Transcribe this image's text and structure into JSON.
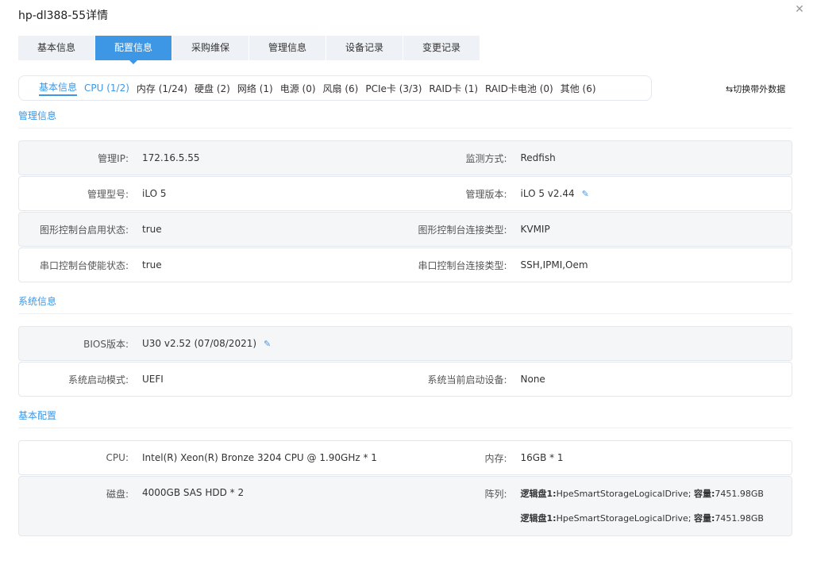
{
  "window": {
    "title": "hp-dl388-55详情"
  },
  "tabs": [
    {
      "label": "基本信息"
    },
    {
      "label": "配置信息"
    },
    {
      "label": "采购维保"
    },
    {
      "label": "管理信息"
    },
    {
      "label": "设备记录"
    },
    {
      "label": "变更记录"
    }
  ],
  "subtabs": [
    {
      "label": "基本信息"
    },
    {
      "label": "CPU (1/2)"
    },
    {
      "label": "内存 (1/24)"
    },
    {
      "label": "硬盘 (2)"
    },
    {
      "label": "网络 (1)"
    },
    {
      "label": "电源 (0)"
    },
    {
      "label": "风扇 (6)"
    },
    {
      "label": "PCIe卡 (3/3)"
    },
    {
      "label": "RAID卡 (1)"
    },
    {
      "label": "RAID卡电池 (0)"
    },
    {
      "label": "其他 (6)"
    }
  ],
  "oob_toggle": "⇆切换带外数据",
  "mgmt": {
    "title": "管理信息",
    "rows": [
      {
        "l1": "管理IP:",
        "v1": "172.16.5.55",
        "l2": "监测方式:",
        "v2": "Redfish"
      },
      {
        "l1": "管理型号:",
        "v1": "iLO 5",
        "l2": "管理版本:",
        "v2": "iLO 5 v2.44"
      },
      {
        "l1": "图形控制台启用状态:",
        "v1": "true",
        "l2": "图形控制台连接类型:",
        "v2": "KVMIP"
      },
      {
        "l1": "串口控制台使能状态:",
        "v1": "true",
        "l2": "串口控制台连接类型:",
        "v2": "SSH,IPMI,Oem"
      }
    ]
  },
  "sys": {
    "title": "系统信息",
    "bios_label": "BIOS版本:",
    "bios_value": "U30 v2.52 (07/08/2021)",
    "boot_mode_label": "系统启动模式:",
    "boot_mode_value": "UEFI",
    "boot_device_label": "系统当前启动设备:",
    "boot_device_value": "None"
  },
  "basic": {
    "title": "基本配置",
    "cpu_label": "CPU:",
    "cpu_value": "Intel(R) Xeon(R) Bronze 3204 CPU @ 1.90GHz * 1",
    "mem_label": "内存:",
    "mem_value": "16GB * 1",
    "disk_label": "磁盘:",
    "disk_value": "4000GB SAS HDD * 2",
    "array_label": "阵列:",
    "arrays": [
      {
        "name_label": "逻辑盘1:",
        "name": "HpeSmartStorageLogicalDrive;",
        "cap_label": "容量:",
        "cap": "7451.98GB"
      },
      {
        "name_label": "逻辑盘1:",
        "name": "HpeSmartStorageLogicalDrive;",
        "cap_label": "容量:",
        "cap": "7451.98GB"
      }
    ]
  },
  "colors": {
    "accent": "#3d97e4",
    "row_alt": "#f4f6f8",
    "tab_bg": "#eef1f5"
  }
}
